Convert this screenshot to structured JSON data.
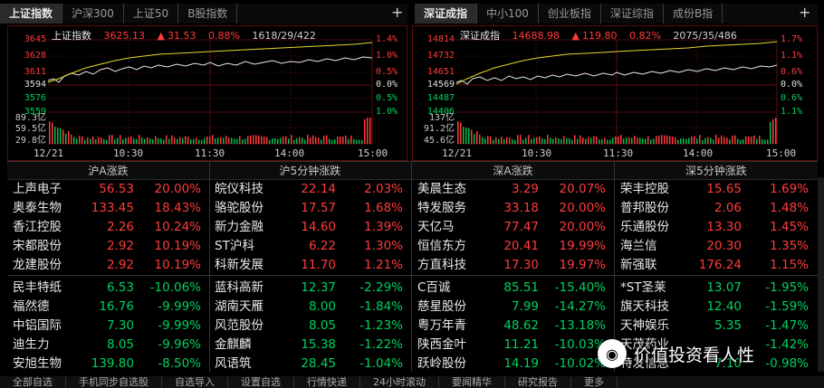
{
  "left_tabs": [
    "上证指数",
    "沪深300",
    "上证50",
    "B股指数"
  ],
  "right_tabs": [
    "深证成指",
    "中小100",
    "创业板指",
    "深证综指",
    "成份B指"
  ],
  "plus": "+",
  "left_chart": {
    "name": "上证指数",
    "price": "3625.13",
    "arrow": "▲",
    "change": "31.53",
    "pct": "0.88%",
    "breadth": "1618/29/422",
    "y_left": [
      "3645",
      "3628",
      "3611",
      "3594",
      "3576",
      "3559"
    ],
    "y_right": [
      "1.4%",
      "1.0%",
      "0.5%",
      "0.0%",
      "0.5%",
      "1.0%"
    ],
    "vol": [
      "89.3亿",
      "59.5亿",
      "29.8亿"
    ],
    "x": [
      "12/21",
      "10:30",
      "11:30",
      "14:00",
      "15:00"
    ]
  },
  "right_chart": {
    "name": "深证成指",
    "price": "14688.98",
    "arrow": "▲",
    "change": "119.80",
    "pct": "0.82%",
    "breadth": "2075/35/486",
    "y_left": [
      "14814",
      "14732",
      "14651",
      "14569",
      "14487",
      "14406"
    ],
    "y_right": [
      "1.7%",
      "1.1%",
      "0.6%",
      "0.0%",
      "0.6%",
      "1.1%"
    ],
    "vol": [
      "137亿",
      "91.2亿",
      "45.6亿"
    ],
    "x": [
      "12/21",
      "10:30",
      "11:30",
      "14:00",
      "15:00"
    ]
  },
  "boards": [
    {
      "title": "沪A涨跌",
      "up": [
        [
          "上声电子",
          "56.53",
          "20.00%"
        ],
        [
          "奥泰生物",
          "133.45",
          "18.43%"
        ],
        [
          "香江控股",
          "2.26",
          "10.24%"
        ],
        [
          "宋都股份",
          "2.92",
          "10.19%"
        ],
        [
          "龙建股份",
          "2.92",
          "10.19%"
        ]
      ],
      "down": [
        [
          "民丰特纸",
          "6.53",
          "-10.06%"
        ],
        [
          "福然德",
          "16.76",
          "-9.99%"
        ],
        [
          "中铝国际",
          "7.30",
          "-9.99%"
        ],
        [
          "迪生力",
          "8.05",
          "-9.96%"
        ],
        [
          "安旭生物",
          "139.80",
          "-8.50%"
        ]
      ]
    },
    {
      "title": "沪5分钟涨跌",
      "up": [
        [
          "皖仪科技",
          "22.14",
          "2.03%"
        ],
        [
          "骆驼股份",
          "17.57",
          "1.68%"
        ],
        [
          "新力金融",
          "14.60",
          "1.39%"
        ],
        [
          "ST沪科",
          "6.22",
          "1.30%"
        ],
        [
          "科新发展",
          "11.70",
          "1.21%"
        ]
      ],
      "down": [
        [
          "蓝科高新",
          "12.37",
          "-2.29%"
        ],
        [
          "湖南天雁",
          "8.00",
          "-1.84%"
        ],
        [
          "风范股份",
          "8.05",
          "-1.23%"
        ],
        [
          "金麒麟",
          "15.38",
          "-1.22%"
        ],
        [
          "风语筑",
          "28.45",
          "-1.04%"
        ]
      ]
    },
    {
      "title": "深A涨跌",
      "up": [
        [
          "美晨生态",
          "3.29",
          "20.07%"
        ],
        [
          "特发服务",
          "33.18",
          "20.00%"
        ],
        [
          "天亿马",
          "77.47",
          "20.00%"
        ],
        [
          "恒信东方",
          "20.41",
          "19.99%"
        ],
        [
          "方直科技",
          "17.30",
          "19.97%"
        ]
      ],
      "down": [
        [
          "C百诚",
          "85.51",
          "-15.40%"
        ],
        [
          "慈星股份",
          "7.99",
          "-14.27%"
        ],
        [
          "粤万年青",
          "48.62",
          "-13.18%"
        ],
        [
          "陕西金叶",
          "11.21",
          "-10.03%"
        ],
        [
          "跃岭股份",
          "14.19",
          "-10.02%"
        ]
      ]
    },
    {
      "title": "深5分钟涨跌",
      "up": [
        [
          "荣丰控股",
          "15.65",
          "1.69%"
        ],
        [
          "普邦股份",
          "2.06",
          "1.48%"
        ],
        [
          "乐通股份",
          "13.30",
          "1.45%"
        ],
        [
          "海兰信",
          "20.30",
          "1.35%"
        ],
        [
          "新强联",
          "176.24",
          "1.15%"
        ]
      ],
      "down": [
        [
          "*ST圣莱",
          "13.07",
          "-1.95%"
        ],
        [
          "旗天科技",
          "12.40",
          "-1.59%"
        ],
        [
          "天神娱乐",
          "5.35",
          "-1.47%"
        ],
        [
          "天茂药业",
          "",
          "-1.42%"
        ],
        [
          "特发信息",
          "7.10",
          "-0.98%"
        ]
      ]
    }
  ],
  "bottom": [
    "全部自选",
    "手机同步自选股",
    "自选导入",
    "设置自选",
    "行情快递",
    "24小时滚动",
    "要闻精华",
    "研究报告",
    "更多"
  ],
  "watermark": "价值投资看人性"
}
